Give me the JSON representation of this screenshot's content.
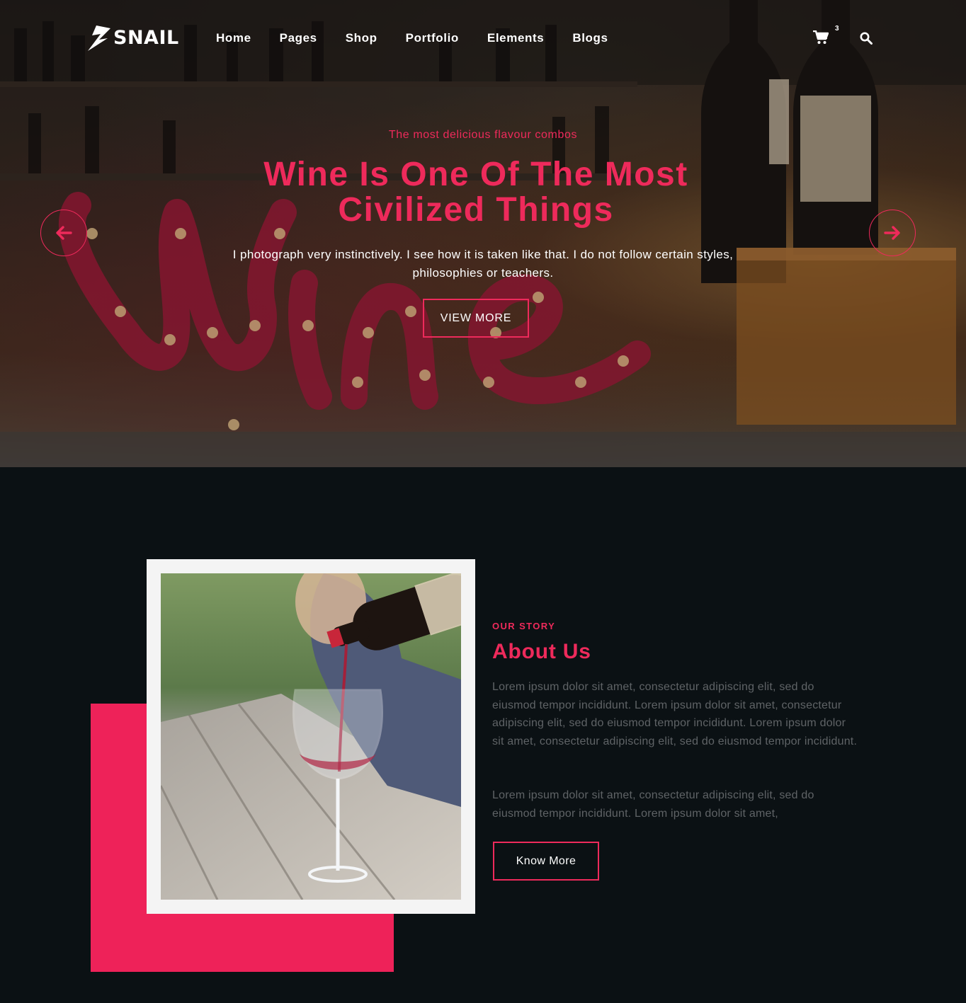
{
  "header": {
    "logo_text": "SNAIL",
    "nav": [
      "Home",
      "Pages",
      "Shop",
      "Portfolio",
      "Elements",
      "Blogs"
    ],
    "cart_count": "3",
    "icons": [
      "cart-icon",
      "search-icon"
    ]
  },
  "hero": {
    "subtitle": "The most delicious flavour combos",
    "title": "Wine Is One Of The Most Civilized Things",
    "description": "I photograph very instinctively. I see how it is taken like that. I do not follow certain styles, philosophies or teachers.",
    "button_label": "VIEW MORE",
    "prev_icon": "arrow-left-icon",
    "next_icon": "arrow-right-icon"
  },
  "about": {
    "label": "OUR STORY",
    "title": "About Us",
    "paragraph1": "Lorem ipsum dolor sit amet, consectetur adipiscing elit, sed do eiusmod tempor incididunt. Lorem ipsum dolor sit amet, consectetur adipiscing elit, sed do eiusmod tempor incididunt. Lorem ipsum dolor sit amet, consectetur adipiscing elit, sed do eiusmod tempor incididunt.",
    "paragraph2": "Lorem ipsum dolor sit amet, consectetur adipiscing elit, sed do eiusmod tempor incididunt. Lorem ipsum dolor sit amet,",
    "button_label": "Know More"
  },
  "colors": {
    "accent": "#ee2a5b",
    "background": "#0b1114",
    "text_muted": "#5f6366",
    "photo_frame": "#f4f4f4"
  }
}
